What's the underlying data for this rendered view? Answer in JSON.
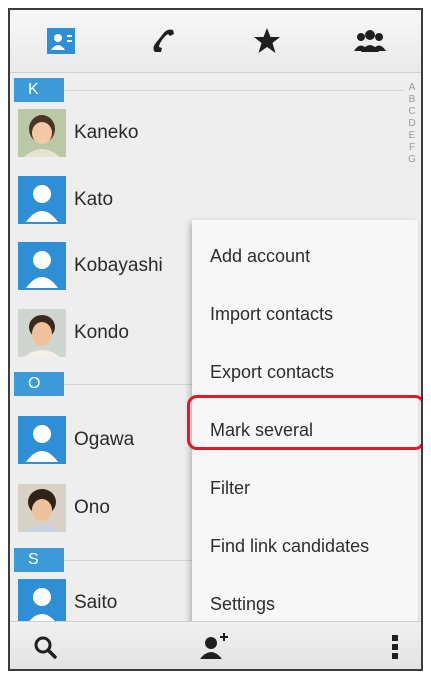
{
  "tabs": [
    {
      "icon": "contacts-card-icon",
      "selected": true
    },
    {
      "icon": "phone-icon",
      "selected": false
    },
    {
      "icon": "star-icon",
      "selected": false
    },
    {
      "icon": "group-icon",
      "selected": false
    }
  ],
  "sections": [
    {
      "letter": "K",
      "contacts": [
        {
          "name": "Kaneko",
          "avatar": "photo-child-1"
        },
        {
          "name": "Kato",
          "avatar": "default-person-icon"
        },
        {
          "name": "Kobayashi",
          "avatar": "default-person-icon"
        },
        {
          "name": "Kondo",
          "avatar": "photo-child-2"
        }
      ]
    },
    {
      "letter": "O",
      "contacts": [
        {
          "name": "Ogawa",
          "avatar": "default-person-icon"
        },
        {
          "name": "Ono",
          "avatar": "photo-child-3"
        }
      ]
    },
    {
      "letter": "S",
      "contacts": [
        {
          "name": "Saito",
          "avatar": "default-person-icon"
        }
      ]
    }
  ],
  "index_letters": [
    "A",
    "B",
    "C",
    "D",
    "E",
    "F",
    "G"
  ],
  "menu": {
    "items": [
      "Add account",
      "Import contacts",
      "Export contacts",
      "Mark several",
      "Filter",
      "Find link candidates",
      "Settings"
    ],
    "highlighted_item": "Mark several",
    "highlight_color": "#e0192b"
  },
  "bottom_bar": {
    "icons": [
      "search-icon",
      "add-contact-icon",
      "more-vert-icon"
    ]
  },
  "colors": {
    "accent": "#3b9ad8",
    "tab_selected": "#2f8fd6",
    "icon_dark": "#1f1f1f"
  }
}
